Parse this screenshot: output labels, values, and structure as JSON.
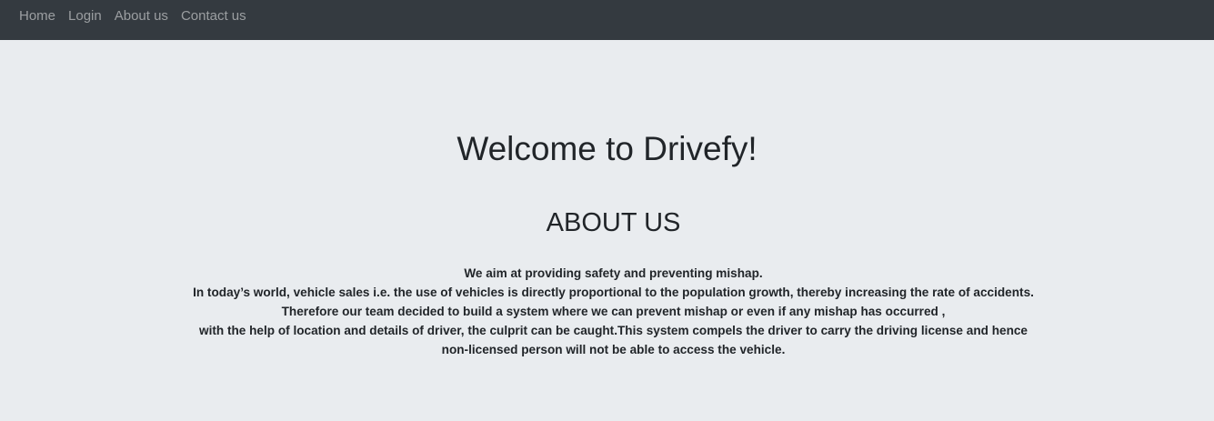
{
  "nav": {
    "items": [
      {
        "label": "Home"
      },
      {
        "label": "Login"
      },
      {
        "label": "About us"
      },
      {
        "label": "Contact us"
      }
    ]
  },
  "main": {
    "title": "Welcome to Drivefy!",
    "about_heading": "ABOUT US",
    "about_lines": [
      "We aim at providing safety and preventing mishap.",
      "In today’s world, vehicle sales i.e. the use of vehicles is directly proportional to the population growth, thereby increasing the rate of accidents.",
      "Therefore our team decided to build a system where we can prevent mishap or even if any mishap has occurred ,",
      "with the help of location and details of driver, the culprit can be caught.This system compels the driver to carry the driving license and hence",
      "non-licensed person will not be able to access the vehicle."
    ]
  },
  "colors": {
    "navbar_bg": "#343a40",
    "page_bg": "#e9ecef",
    "text": "#212529"
  }
}
